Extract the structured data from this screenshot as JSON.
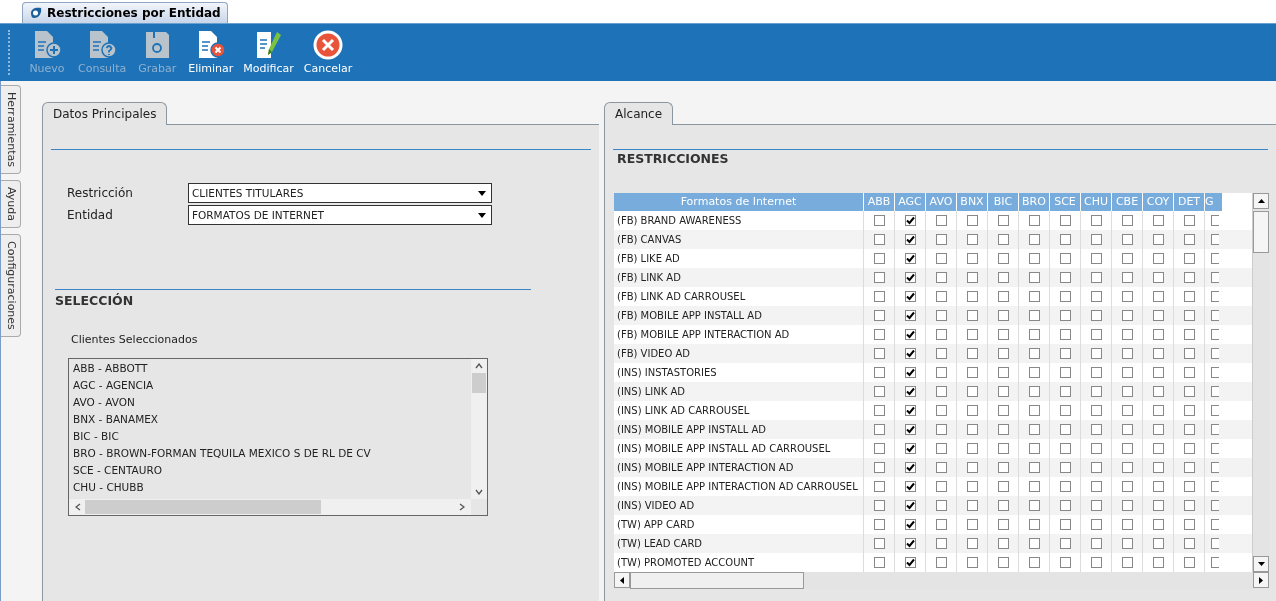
{
  "window": {
    "tab_title": "Restricciones por Entidad"
  },
  "toolbar": [
    {
      "label": "Nuevo",
      "kind": "new",
      "disabled": true
    },
    {
      "label": "Consulta",
      "kind": "query",
      "disabled": true
    },
    {
      "label": "Grabar",
      "kind": "save",
      "disabled": true
    },
    {
      "label": "Eliminar",
      "kind": "delete",
      "disabled": false
    },
    {
      "label": "Modificar",
      "kind": "edit",
      "disabled": false
    },
    {
      "label": "Cancelar",
      "kind": "cancel",
      "disabled": false
    }
  ],
  "side_tabs": [
    "Herramientas",
    "Ayuda",
    "Configuraciones"
  ],
  "left_panel": {
    "tab": "Datos Principales",
    "fields": [
      {
        "label": "Restricción",
        "value": "CLIENTES TITULARES"
      },
      {
        "label": "Entidad",
        "value": "FORMATOS DE INTERNET"
      }
    ],
    "section_title": "SELECCIÓN",
    "list_title": "Clientes Seleccionados",
    "list_items": [
      "ABB - ABBOTT",
      "AGC - AGENCIA",
      "AVO - AVON",
      "BNX - BANAMEX",
      "BIC - BIC",
      "BRO - BROWN-FORMAN TEQUILA MEXICO S DE RL DE CV",
      "SCE - CENTAURO",
      "CHU - CHUBB"
    ]
  },
  "right_panel": {
    "tab": "Alcance",
    "section_title": "RESTRICCIONES",
    "columns": [
      "Formatos de Internet",
      "ABB",
      "AGC",
      "AVO",
      "BNX",
      "BIC",
      "BRO",
      "SCE",
      "CHU",
      "CBE",
      "COY",
      "DET",
      "G"
    ],
    "rows": [
      {
        "label": "(FB) BRAND AWARENESS",
        "checks": [
          false,
          true,
          false,
          false,
          false,
          false,
          false,
          false,
          false,
          false,
          false,
          false
        ]
      },
      {
        "label": "(FB) CANVAS",
        "checks": [
          false,
          true,
          false,
          false,
          false,
          false,
          false,
          false,
          false,
          false,
          false,
          false
        ]
      },
      {
        "label": "(FB) LIKE AD",
        "checks": [
          false,
          true,
          false,
          false,
          false,
          false,
          false,
          false,
          false,
          false,
          false,
          false
        ]
      },
      {
        "label": "(FB) LINK AD",
        "checks": [
          false,
          true,
          false,
          false,
          false,
          false,
          false,
          false,
          false,
          false,
          false,
          false
        ]
      },
      {
        "label": "(FB) LINK AD CARROUSEL",
        "checks": [
          false,
          true,
          false,
          false,
          false,
          false,
          false,
          false,
          false,
          false,
          false,
          false
        ]
      },
      {
        "label": "(FB) MOBILE APP INSTALL AD",
        "checks": [
          false,
          true,
          false,
          false,
          false,
          false,
          false,
          false,
          false,
          false,
          false,
          false
        ]
      },
      {
        "label": "(FB) MOBILE APP INTERACTION AD",
        "checks": [
          false,
          true,
          false,
          false,
          false,
          false,
          false,
          false,
          false,
          false,
          false,
          false
        ]
      },
      {
        "label": "(FB) VIDEO AD",
        "checks": [
          false,
          true,
          false,
          false,
          false,
          false,
          false,
          false,
          false,
          false,
          false,
          false
        ]
      },
      {
        "label": "(INS) INSTASTORIES",
        "checks": [
          false,
          true,
          false,
          false,
          false,
          false,
          false,
          false,
          false,
          false,
          false,
          false
        ]
      },
      {
        "label": "(INS) LINK AD",
        "checks": [
          false,
          true,
          false,
          false,
          false,
          false,
          false,
          false,
          false,
          false,
          false,
          false
        ]
      },
      {
        "label": "(INS) LINK AD CARROUSEL",
        "checks": [
          false,
          true,
          false,
          false,
          false,
          false,
          false,
          false,
          false,
          false,
          false,
          false
        ]
      },
      {
        "label": "(INS) MOBILE APP INSTALL AD",
        "checks": [
          false,
          true,
          false,
          false,
          false,
          false,
          false,
          false,
          false,
          false,
          false,
          false
        ]
      },
      {
        "label": "(INS) MOBILE APP INSTALL AD CARROUSEL",
        "checks": [
          false,
          true,
          false,
          false,
          false,
          false,
          false,
          false,
          false,
          false,
          false,
          false
        ]
      },
      {
        "label": "(INS) MOBILE APP INTERACTION AD",
        "checks": [
          false,
          true,
          false,
          false,
          false,
          false,
          false,
          false,
          false,
          false,
          false,
          false
        ]
      },
      {
        "label": "(INS) MOBILE APP INTERACTION AD CARROUSEL",
        "checks": [
          false,
          true,
          false,
          false,
          false,
          false,
          false,
          false,
          false,
          false,
          false,
          false
        ]
      },
      {
        "label": "(INS) VIDEO AD",
        "checks": [
          false,
          true,
          false,
          false,
          false,
          false,
          false,
          false,
          false,
          false,
          false,
          false
        ]
      },
      {
        "label": "(TW) APP CARD",
        "checks": [
          false,
          true,
          false,
          false,
          false,
          false,
          false,
          false,
          false,
          false,
          false,
          false
        ]
      },
      {
        "label": "(TW) LEAD CARD",
        "checks": [
          false,
          true,
          false,
          false,
          false,
          false,
          false,
          false,
          false,
          false,
          false,
          false
        ]
      },
      {
        "label": "(TW) PROMOTED ACCOUNT",
        "checks": [
          false,
          true,
          false,
          false,
          false,
          false,
          false,
          false,
          false,
          false,
          false,
          false
        ]
      }
    ]
  }
}
